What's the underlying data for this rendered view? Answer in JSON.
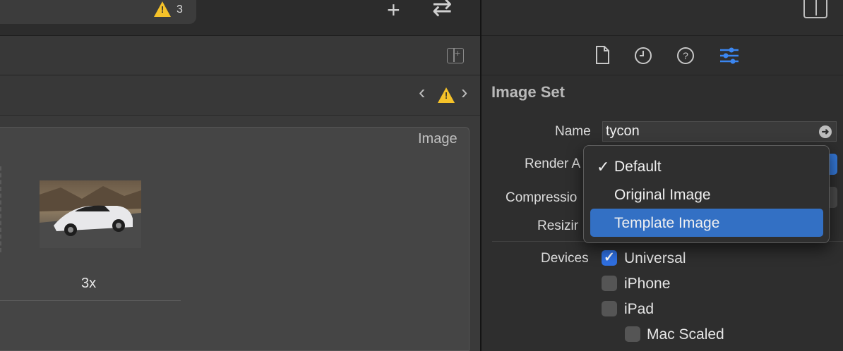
{
  "toolbar": {
    "warning_count": "3",
    "add_icon": "plus-icon",
    "swap_icon": "swap-arrows-icon"
  },
  "editor": {
    "slot_title": "Image",
    "scale_label": "3x",
    "thumbnail": "porsche-taycan-car-photo"
  },
  "inspector": {
    "section_title": "Image Set",
    "name_label": "Name",
    "name_value": "tycon",
    "render_as_label": "Render A",
    "compression_label": "Compressio",
    "resizing_label": "Resizir",
    "devices_label": "Devices",
    "tabs": [
      "file-icon",
      "clock-icon",
      "help-icon",
      "attributes-icon"
    ]
  },
  "render_menu": {
    "items": [
      {
        "label": "Default",
        "checked": true
      },
      {
        "label": "Original Image",
        "checked": false
      },
      {
        "label": "Template Image",
        "highlighted": true
      }
    ]
  },
  "devices": [
    {
      "label": "Universal",
      "checked": true
    },
    {
      "label": "iPhone",
      "checked": false
    },
    {
      "label": "iPad",
      "checked": false
    },
    {
      "label": "Mac Scaled",
      "checked": false
    }
  ],
  "colors": {
    "accent": "#3370c4",
    "warning": "#f5c229"
  }
}
